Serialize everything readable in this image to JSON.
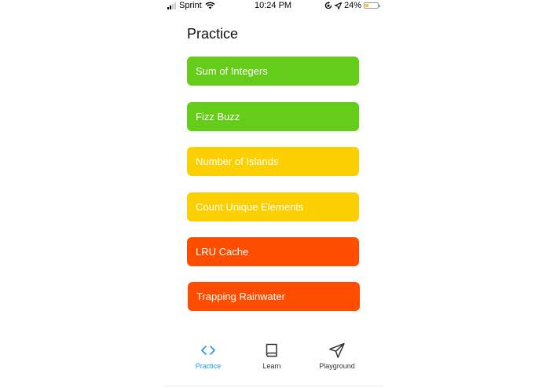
{
  "status_bar": {
    "carrier": "Sprint",
    "time": "10:24 PM",
    "battery_percent_label": "24%",
    "battery_level": 0.24,
    "battery_color": "#f7c41b",
    "signal_bars_filled": 2,
    "signal_bars_total": 4
  },
  "header": {
    "title": "Practice"
  },
  "problems": [
    {
      "label": "Sum of Integers",
      "color": "#66cc1a"
    },
    {
      "label": "Fizz Buzz",
      "color": "#66cc1a"
    },
    {
      "label": "Number of Islands",
      "color": "#fcd000"
    },
    {
      "label": "Count Unique Elements",
      "color": "#fcd000"
    },
    {
      "label": "LRU Cache",
      "color": "#ff4d00"
    },
    {
      "label": "Trapping Rainwater",
      "color": "#ff4d00"
    }
  ],
  "tab_bar": {
    "active_color": "#1e9be8",
    "tabs": [
      {
        "label": "Practice",
        "icon": "code-brackets-icon",
        "active": true
      },
      {
        "label": "Learn",
        "icon": "book-icon",
        "active": false
      },
      {
        "label": "Playground",
        "icon": "send-icon",
        "active": false
      }
    ]
  }
}
